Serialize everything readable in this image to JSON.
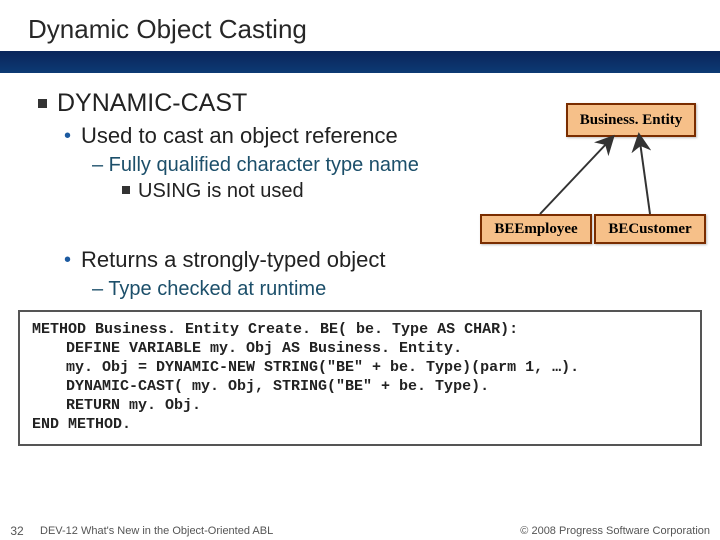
{
  "title": "Dynamic Object Casting",
  "bullets": {
    "main": "DYNAMIC-CAST",
    "sub1": "Used to cast an object reference",
    "dash1": "– Fully qualified character type name",
    "inner1": "USING is not used",
    "sub2": "Returns a strongly-typed object",
    "dash2": "– Type checked at runtime"
  },
  "boxes": {
    "be": "Business. Entity",
    "emp": "BEEmployee",
    "cus": "BECustomer"
  },
  "code": {
    "l1": "METHOD Business. Entity Create. BE( be. Type AS CHAR):",
    "l2": "DEFINE VARIABLE my. Obj AS Business. Entity.",
    "l3": "my. Obj = DYNAMIC-NEW STRING(\"BE\" + be. Type)(parm 1, …).",
    "l4": "DYNAMIC-CAST( my. Obj, STRING(\"BE\" + be. Type).",
    "l5": "RETURN my. Obj.",
    "l6": "END METHOD."
  },
  "footer": {
    "page": "32",
    "session": "DEV-12 What's New in the Object-Oriented ABL",
    "copyright": "© 2008 Progress Software Corporation"
  }
}
